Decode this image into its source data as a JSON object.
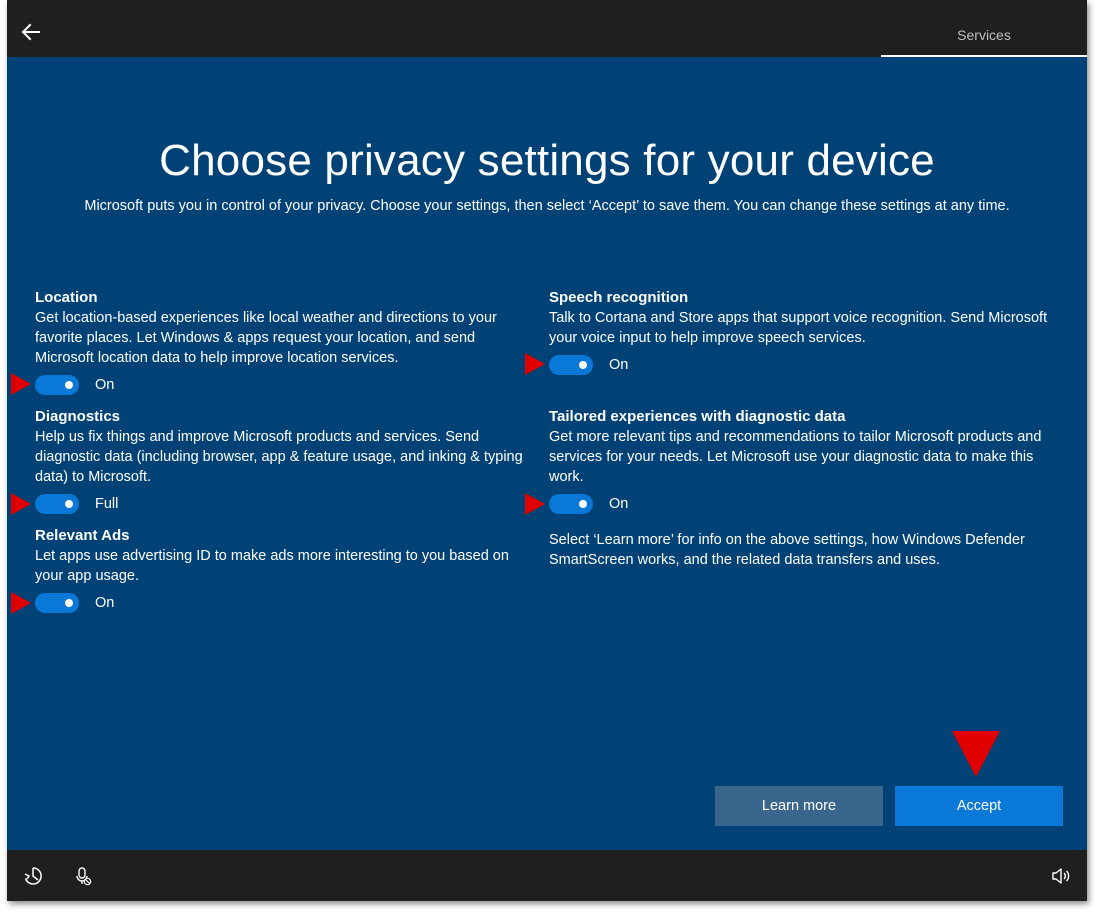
{
  "header": {
    "back_icon": "arrow-left-icon",
    "tab_label": "Services"
  },
  "main": {
    "title": "Choose privacy settings for your device",
    "subtitle": "Microsoft puts you in control of your privacy. Choose your settings, then select ‘Accept’ to save them. You can change these settings at any time."
  },
  "settings": {
    "location": {
      "title": "Location",
      "description": "Get location-based experiences like local weather and directions to your favorite places. Let Windows & apps request your location, and send Microsoft location data to help improve location services.",
      "state": "On"
    },
    "diagnostics": {
      "title": "Diagnostics",
      "description": "Help us fix things and improve Microsoft products and services. Send diagnostic data (including browser, app & feature usage, and inking & typing data) to Microsoft.",
      "state": "Full"
    },
    "relevant_ads": {
      "title": "Relevant Ads",
      "description": "Let apps use advertising ID to make ads more interesting to you based on your app usage.",
      "state": "On"
    },
    "speech": {
      "title": "Speech recognition",
      "description": "Talk to Cortana and Store apps that support voice recognition. Send Microsoft your voice input to help improve speech services.",
      "state": "On"
    },
    "tailored": {
      "title": "Tailored experiences with diagnostic data",
      "description": "Get more relevant tips and recommendations to tailor Microsoft products and services for your needs. Let Microsoft use your diagnostic data to make this work.",
      "state": "On"
    }
  },
  "info_text": "Select ‘Learn more’ for info on the above settings, how Windows Defender SmartScreen works, and the related data transfers and uses.",
  "buttons": {
    "learn_more": "Learn more",
    "accept": "Accept"
  },
  "footer": {
    "icons": [
      "ease-of-access-icon",
      "microphone-muted-icon",
      "volume-icon"
    ]
  },
  "colors": {
    "background": "#004275",
    "bar": "#1f1f1f",
    "toggle_on": "#0a78d7",
    "accept_button": "#0a78d7",
    "learn_more_button": "#3a668e",
    "annotation_arrow": "#e00000"
  }
}
